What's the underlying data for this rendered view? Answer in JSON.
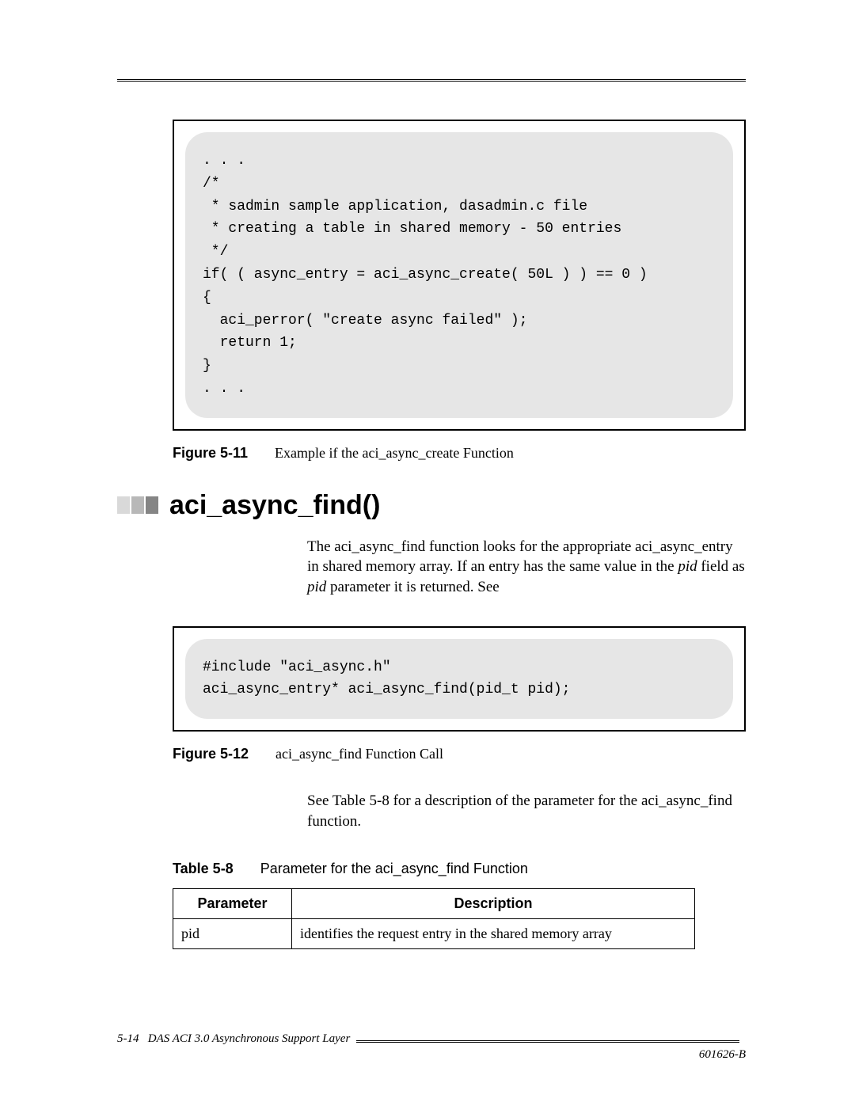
{
  "code1": ". . .\n/*\n * sadmin sample application, dasadmin.c file\n * creating a table in shared memory - 50 entries\n */\nif( ( async_entry = aci_async_create( 50L ) ) == 0 )\n{\n  aci_perror( \"create async failed\" );\n  return 1;\n}\n. . .",
  "fig11_label": "Figure 5-11",
  "fig11_caption": "Example if the aci_async_create Function",
  "section_title": "aci_async_find()",
  "para1_a": "The aci_async_find function looks for the appropriate aci_async_entry in shared memory array. If an entry has the same value in the ",
  "para1_i1": "pid",
  "para1_b": " field as ",
  "para1_i2": "pid",
  "para1_c": " parameter it is returned. See",
  "code2": "#include \"aci_async.h\"\naci_async_entry* aci_async_find(pid_t pid);",
  "fig12_label": "Figure 5-12",
  "fig12_caption": "aci_async_find Function Call",
  "para2": "See Table 5-8 for a description of the parameter for the aci_async_find function.",
  "tab8_label": "Table 5-8",
  "tab8_caption": "Parameter for the aci_async_find Function",
  "table": {
    "header_param": "Parameter",
    "header_desc": "Description",
    "rows": [
      {
        "param": "pid",
        "desc": "identifies the request entry in the shared memory array"
      }
    ]
  },
  "footer_page": "5-14",
  "footer_title": "DAS ACI 3.0 Asynchronous Support Layer",
  "footer_docid": "601626-B"
}
